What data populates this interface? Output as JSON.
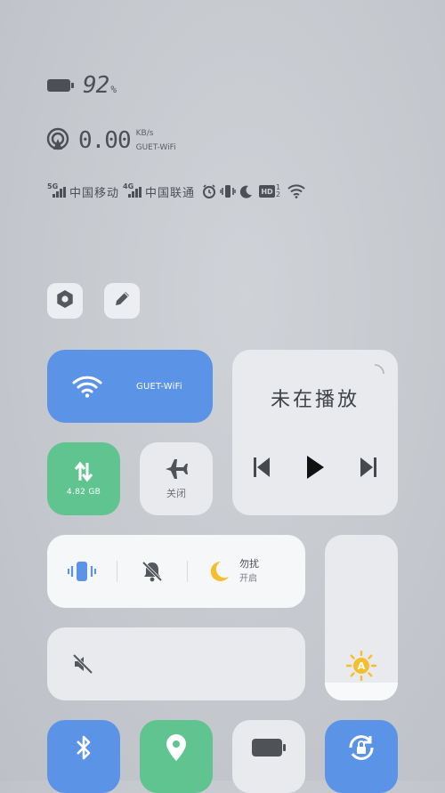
{
  "status": {
    "battery_percent": "92",
    "battery_unit": "%",
    "net_speed": "0.00",
    "net_speed_unit": "KB/s",
    "wifi_name": "GUET-WiFi",
    "carriers": [
      {
        "gen": "5G",
        "name": "中国移动"
      },
      {
        "gen": "4G",
        "name": "中国联通"
      }
    ],
    "status_icons": [
      "alarm-icon",
      "vibrate-icon",
      "moon-icon",
      "hd-voice-icon",
      "wifi-icon"
    ],
    "hd_label": "HD",
    "hd_sub_top": "1",
    "hd_sub_bottom": "2"
  },
  "top_buttons": {
    "settings_icon": "gear-icon",
    "edit_icon": "pencil-icon"
  },
  "tiles": {
    "wifi": {
      "label": "GUET-WiFi",
      "icon": "wifi-icon",
      "active": true
    },
    "media": {
      "title": "未在播放",
      "controls": [
        "previous-icon",
        "play-icon",
        "next-icon"
      ]
    },
    "mobile_data": {
      "label": "4.82 GB",
      "icon": "data-transfer-icon",
      "active": true
    },
    "airplane": {
      "label": "关闭",
      "icon": "airplane-icon",
      "active": false
    },
    "modes": {
      "vibrate_icon": "vibrate-icon",
      "mute_icon": "bell-off-icon",
      "dnd_title": "勿扰",
      "dnd_sub": "开启"
    },
    "volume": {
      "icon": "volume-mute-icon",
      "level": 0
    },
    "brightness": {
      "icon": "auto-brightness-icon",
      "auto_label": "A",
      "level": 0.11
    },
    "bluetooth": {
      "icon": "bluetooth-icon",
      "active": true
    },
    "location": {
      "icon": "location-icon",
      "active": true
    },
    "battery_saver": {
      "icon": "battery-icon",
      "active": false
    },
    "rotation_lock": {
      "icon": "rotation-lock-icon",
      "active": true
    }
  },
  "colors": {
    "accent_blue": "#5b93e6",
    "accent_green": "#5fc48f",
    "tile_off": "#e8eaed",
    "sun_yellow": "#f5be2e"
  }
}
